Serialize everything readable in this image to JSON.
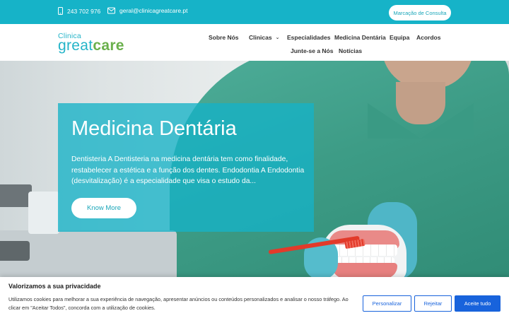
{
  "topbar": {
    "phone": "243 702 976",
    "email": "geral@clinicagreatcare.pt",
    "cta_label": "Marcação de Consulta",
    "phone_icon": "phone-icon",
    "email_icon": "envelope-icon",
    "bg_color": "#16b3c8"
  },
  "logo": {
    "small": "Clinica",
    "great": "great",
    "care": "care"
  },
  "nav": {
    "items": [
      {
        "label": "Sobre Nós"
      },
      {
        "label": "Clinicas"
      },
      {
        "label": "Especialidades"
      },
      {
        "label": "Medicina Dentária"
      },
      {
        "label": "Equipa"
      },
      {
        "label": "Acordos"
      },
      {
        "label": "Junte-se a Nós"
      },
      {
        "label": "Notícias"
      }
    ],
    "dropdown_icon": "chevron-down-icon"
  },
  "hero": {
    "title": "Medicina Dentária",
    "text": "Dentisteria A Dentisteria na medicina dentária tem como finalidade, restabelecer a estética e a função dos dentes. Endodontia A Endodontia (desvitalização) é a especialidade que visa o estudo da...",
    "button_label": "Know More",
    "accent_color": "#16b2c6"
  },
  "cookie": {
    "title": "Valorizamos a sua privacidade",
    "text": "Utilizamos cookies para melhorar a sua experiência de navegação, apresentar anúncios ou conteúdos personalizados e analisar o nosso tráfego. Ao clicar em \"Aceitar Todos\", concorda com a utilização de cookies.",
    "customize_label": "Personalizar",
    "reject_label": "Rejeitar",
    "accept_label": "Aceite tudo",
    "button_color": "#1863dc"
  }
}
